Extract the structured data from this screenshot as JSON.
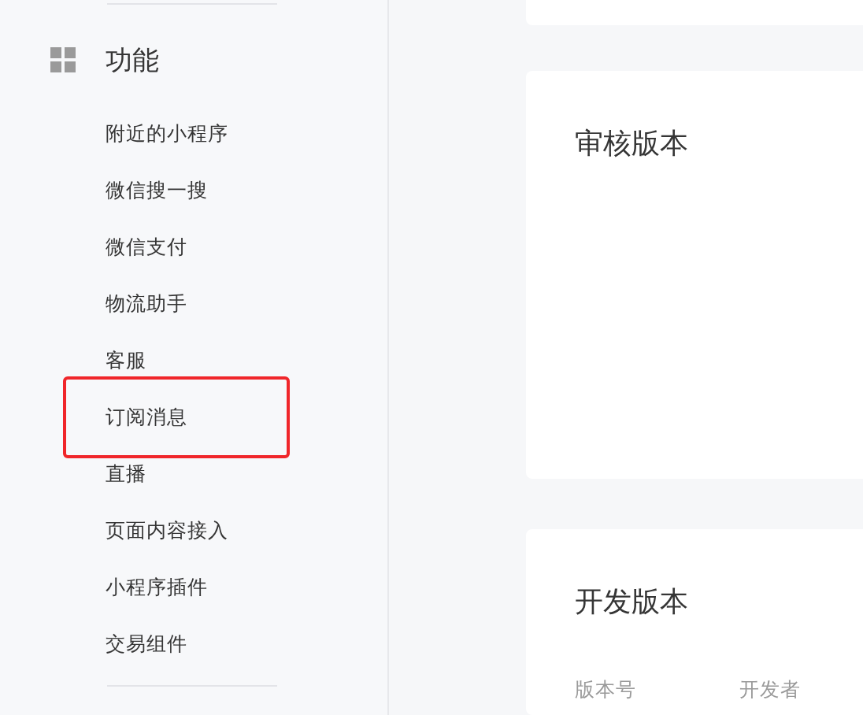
{
  "sidebar": {
    "section": {
      "title": "功能",
      "items": [
        {
          "label": "附近的小程序",
          "highlighted": false
        },
        {
          "label": "微信搜一搜",
          "highlighted": false
        },
        {
          "label": "微信支付",
          "highlighted": false
        },
        {
          "label": "物流助手",
          "highlighted": false
        },
        {
          "label": "客服",
          "highlighted": false
        },
        {
          "label": "订阅消息",
          "highlighted": true
        },
        {
          "label": "直播",
          "highlighted": false
        },
        {
          "label": "页面内容接入",
          "highlighted": false
        },
        {
          "label": "小程序插件",
          "highlighted": false
        },
        {
          "label": "交易组件",
          "highlighted": false
        }
      ]
    }
  },
  "main": {
    "review_card": {
      "title": "审核版本"
    },
    "dev_card": {
      "title": "开发版本",
      "columns": [
        "版本号",
        "开发者"
      ]
    }
  }
}
